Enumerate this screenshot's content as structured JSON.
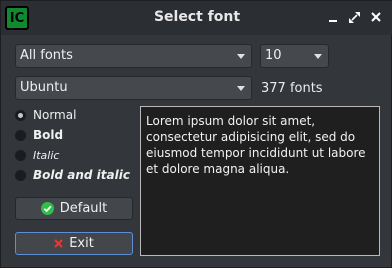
{
  "window": {
    "icon_text": "IC",
    "title": "Select font"
  },
  "filter_combo": {
    "value": "All fonts"
  },
  "size_combo": {
    "value": "10"
  },
  "font_combo": {
    "value": "Ubuntu"
  },
  "font_count": "377 fonts",
  "styles": [
    {
      "label": "Normal",
      "checked": true
    },
    {
      "label": "Bold",
      "checked": false
    },
    {
      "label": "Italic",
      "checked": false
    },
    {
      "label": "Bold and italic",
      "checked": false
    }
  ],
  "buttons": {
    "default_label": "Default",
    "exit_label": "Exit"
  },
  "preview_text": "Lorem ipsum dolor sit amet, consectetur adipisicing elit, sed do eiusmod tempor incididunt ut labore et dolore magna aliqua.",
  "colors": {
    "default_icon": "#2fbf4a",
    "exit_icon": "#e03a3a",
    "app_icon": "#0f8a2e"
  },
  "icons": [
    "minimize-icon",
    "restore-icon",
    "close-icon",
    "check-circle-icon",
    "x-icon"
  ]
}
